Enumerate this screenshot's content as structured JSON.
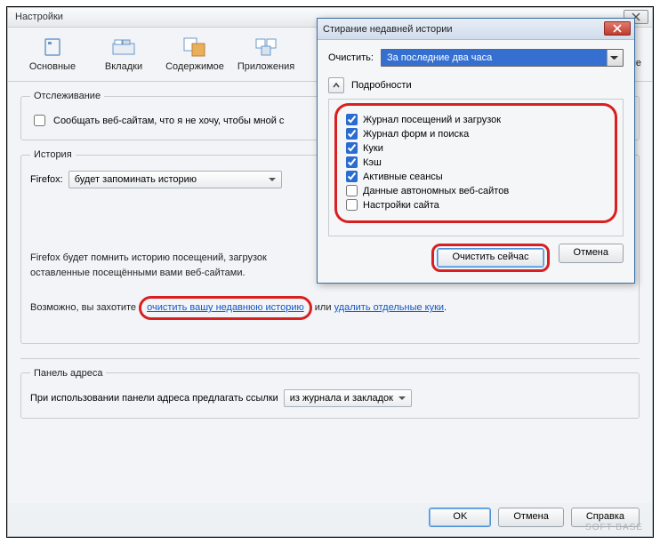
{
  "main": {
    "title": "Настройки",
    "toolbar": [
      {
        "label": "Основные"
      },
      {
        "label": "Вкладки"
      },
      {
        "label": "Содержимое"
      },
      {
        "label": "Приложения"
      },
      {
        "label": "ые"
      }
    ]
  },
  "tracking": {
    "legend": "Отслеживание",
    "checkbox_label": "Сообщать веб-сайтам, что я не хочу, чтобы мной с"
  },
  "history": {
    "legend": "История",
    "label": "Firefox:",
    "dropdown": "будет запоминать историю",
    "body1": "Firefox будет помнить историю посещений, загрузок",
    "body2": "оставленные посещёнными вами веб-сайтами.",
    "body3_pre": "Возможно, вы захотите ",
    "link1": "очистить вашу недавнюю историю",
    "body3_mid": " или ",
    "link2": "удалить отдельные куки",
    "body3_post": "."
  },
  "addressbar": {
    "legend": "Панель адреса",
    "label": "При использовании панели адреса предлагать ссылки",
    "dropdown": "из журнала и закладок"
  },
  "buttons": {
    "ok": "OK",
    "cancel": "Отмена",
    "help": "Справка"
  },
  "dialog": {
    "title": "Стирание недавней истории",
    "clear_label": "Очистить:",
    "clear_dropdown": "За последние два часа",
    "details_label": "Подробности",
    "checks": [
      {
        "label": "Журнал посещений и загрузок",
        "checked": true
      },
      {
        "label": "Журнал форм и поиска",
        "checked": true
      },
      {
        "label": "Куки",
        "checked": true
      },
      {
        "label": "Кэш",
        "checked": true
      },
      {
        "label": "Активные сеансы",
        "checked": true
      },
      {
        "label": "Данные автономных веб-сайтов",
        "checked": false
      },
      {
        "label": "Настройки сайта",
        "checked": false
      }
    ],
    "clear_now": "Очистить сейчас",
    "cancel": "Отмена"
  },
  "watermark": "SOFT BASE"
}
